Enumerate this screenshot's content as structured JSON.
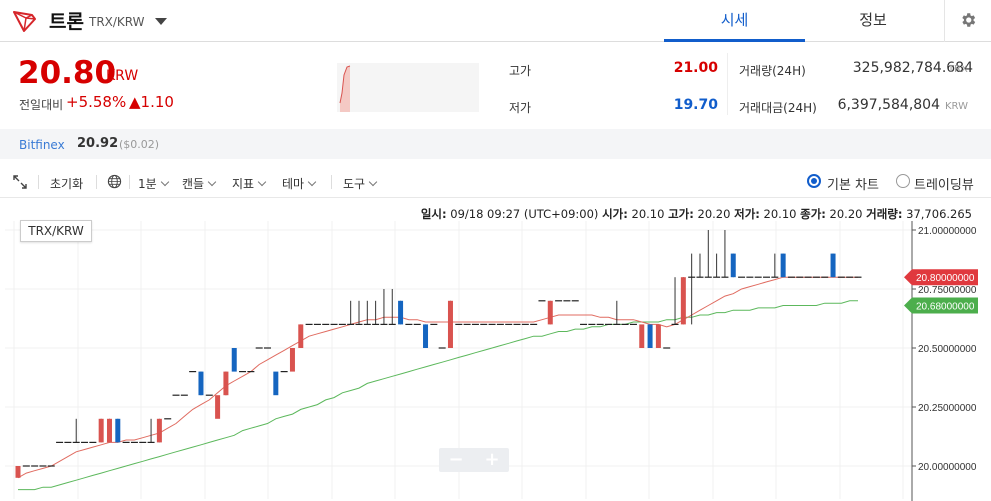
{
  "header": {
    "coin_name": "트론",
    "pair": "TRX/KRW",
    "tabs": [
      {
        "label": "시세",
        "active": true
      },
      {
        "label": "정보",
        "active": false
      }
    ],
    "logo_icon": "tron-logo-icon"
  },
  "price": {
    "current": "20.80",
    "unit": "KRW",
    "change_label": "전일대비",
    "change_pct": "+5.58%",
    "change_val": "▲1.10",
    "color_up": "#d60000",
    "color_down": "#115dcb"
  },
  "stats": {
    "high_label": "고가",
    "high": "21.00",
    "low_label": "저가",
    "low": "19.70",
    "volume_label": "거래량(24H)",
    "volume": "325,982,784.684",
    "volume_unit": "TRX",
    "amount_label": "거래대금(24H)",
    "amount": "6,397,584,804",
    "amount_unit": "KRW"
  },
  "exchange": {
    "name": "Bitfinex",
    "price": "20.92",
    "usd": "($0.02)"
  },
  "toolbar": {
    "reset": "초기화",
    "interval": "1분",
    "candle": "캔들",
    "indicator": "지표",
    "theme": "테마",
    "tools": "도구",
    "basic_chart": "기본 차트",
    "trading_view": "트레이딩뷰"
  },
  "chart_info": {
    "date_label": "일시:",
    "date": "09/18 09:27 (UTC+09:00)",
    "open_label": "시가:",
    "open": "20.10",
    "high_label": "고가:",
    "high": "20.20",
    "low_label": "저가:",
    "low": "20.10",
    "close_label": "종가:",
    "close": "20.20",
    "vol_label": "거래량:",
    "vol": "37,706.265",
    "symbol": "TRX/KRW"
  },
  "chart_data": {
    "type": "candlestick",
    "y_ticks": [
      "21.00000000",
      "20.75000000",
      "20.50000000",
      "20.25000000",
      "20.00000000"
    ],
    "ylim": [
      19.95,
      21.05
    ],
    "last_price_label": "20.80000000",
    "ma_label": "20.68000000",
    "up_color": "#d9534f",
    "down_color": "#1565c0",
    "ma_short_color": "#e06b60",
    "ma_long_color": "#5cb85c",
    "candles": [
      {
        "o": 19.95,
        "h": 19.95,
        "l": 19.95,
        "c": 20.0
      },
      {
        "o": 20.0,
        "h": 20.0,
        "l": 20.0,
        "c": 20.0
      },
      {
        "o": 20.0,
        "h": 20.0,
        "l": 20.0,
        "c": 20.0
      },
      {
        "o": 20.0,
        "h": 20.0,
        "l": 20.0,
        "c": 20.0
      },
      {
        "o": 20.0,
        "h": 20.0,
        "l": 20.0,
        "c": 20.0
      },
      {
        "o": 20.1,
        "h": 20.1,
        "l": 20.1,
        "c": 20.1
      },
      {
        "o": 20.1,
        "h": 20.1,
        "l": 20.1,
        "c": 20.1
      },
      {
        "o": 20.1,
        "h": 20.2,
        "l": 20.1,
        "c": 20.1
      },
      {
        "o": 20.1,
        "h": 20.1,
        "l": 20.1,
        "c": 20.1
      },
      {
        "o": 20.1,
        "h": 20.1,
        "l": 20.1,
        "c": 20.1
      },
      {
        "o": 20.1,
        "h": 20.2,
        "l": 20.1,
        "c": 20.2
      },
      {
        "o": 20.1,
        "h": 20.2,
        "l": 20.1,
        "c": 20.2
      },
      {
        "o": 20.2,
        "h": 20.2,
        "l": 20.1,
        "c": 20.1
      },
      {
        "o": 20.1,
        "h": 20.1,
        "l": 20.1,
        "c": 20.1
      },
      {
        "o": 20.1,
        "h": 20.1,
        "l": 20.1,
        "c": 20.1
      },
      {
        "o": 20.1,
        "h": 20.1,
        "l": 20.1,
        "c": 20.1
      },
      {
        "o": 20.1,
        "h": 20.2,
        "l": 20.1,
        "c": 20.1
      },
      {
        "o": 20.1,
        "h": 20.2,
        "l": 20.1,
        "c": 20.2
      },
      {
        "o": 20.2,
        "h": 20.2,
        "l": 20.2,
        "c": 20.2
      },
      {
        "o": 20.3,
        "h": 20.3,
        "l": 20.3,
        "c": 20.3
      },
      {
        "o": 20.3,
        "h": 20.3,
        "l": 20.3,
        "c": 20.3
      },
      {
        "o": 20.4,
        "h": 20.4,
        "l": 20.4,
        "c": 20.4
      },
      {
        "o": 20.4,
        "h": 20.4,
        "l": 20.3,
        "c": 20.3
      },
      {
        "o": 20.3,
        "h": 20.3,
        "l": 20.3,
        "c": 20.3
      },
      {
        "o": 20.2,
        "h": 20.2,
        "l": 20.2,
        "c": 20.3
      },
      {
        "o": 20.3,
        "h": 20.4,
        "l": 20.3,
        "c": 20.4
      },
      {
        "o": 20.5,
        "h": 20.5,
        "l": 20.5,
        "c": 20.4
      },
      {
        "o": 20.4,
        "h": 20.4,
        "l": 20.4,
        "c": 20.4
      },
      {
        "o": 20.4,
        "h": 20.4,
        "l": 20.4,
        "c": 20.4
      },
      {
        "o": 20.5,
        "h": 20.5,
        "l": 20.5,
        "c": 20.5
      },
      {
        "o": 20.5,
        "h": 20.5,
        "l": 20.5,
        "c": 20.5
      },
      {
        "o": 20.4,
        "h": 20.4,
        "l": 20.4,
        "c": 20.3
      },
      {
        "o": 20.4,
        "h": 20.4,
        "l": 20.4,
        "c": 20.4
      },
      {
        "o": 20.4,
        "h": 20.4,
        "l": 20.4,
        "c": 20.5
      },
      {
        "o": 20.5,
        "h": 20.6,
        "l": 20.5,
        "c": 20.6
      },
      {
        "o": 20.6,
        "h": 20.6,
        "l": 20.6,
        "c": 20.6
      },
      {
        "o": 20.6,
        "h": 20.6,
        "l": 20.6,
        "c": 20.6
      },
      {
        "o": 20.6,
        "h": 20.6,
        "l": 20.6,
        "c": 20.6
      },
      {
        "o": 20.6,
        "h": 20.6,
        "l": 20.6,
        "c": 20.6
      },
      {
        "o": 20.6,
        "h": 20.6,
        "l": 20.6,
        "c": 20.6
      },
      {
        "o": 20.6,
        "h": 20.7,
        "l": 20.6,
        "c": 20.6
      },
      {
        "o": 20.6,
        "h": 20.7,
        "l": 20.6,
        "c": 20.6
      },
      {
        "o": 20.6,
        "h": 20.7,
        "l": 20.6,
        "c": 20.6
      },
      {
        "o": 20.6,
        "h": 20.7,
        "l": 20.6,
        "c": 20.6
      },
      {
        "o": 20.6,
        "h": 20.75,
        "l": 20.6,
        "c": 20.6
      },
      {
        "o": 20.6,
        "h": 20.75,
        "l": 20.6,
        "c": 20.6
      },
      {
        "o": 20.7,
        "h": 20.7,
        "l": 20.6,
        "c": 20.6
      },
      {
        "o": 20.6,
        "h": 20.6,
        "l": 20.6,
        "c": 20.6
      },
      {
        "o": 20.6,
        "h": 20.6,
        "l": 20.6,
        "c": 20.6
      },
      {
        "o": 20.6,
        "h": 20.6,
        "l": 20.5,
        "c": 20.5
      },
      {
        "o": 20.6,
        "h": 20.6,
        "l": 20.6,
        "c": 20.6
      },
      {
        "o": 20.5,
        "h": 20.5,
        "l": 20.5,
        "c": 20.5
      },
      {
        "o": 20.5,
        "h": 20.7,
        "l": 20.5,
        "c": 20.7
      },
      {
        "o": 20.6,
        "h": 20.6,
        "l": 20.6,
        "c": 20.6
      },
      {
        "o": 20.6,
        "h": 20.6,
        "l": 20.6,
        "c": 20.6
      },
      {
        "o": 20.6,
        "h": 20.6,
        "l": 20.6,
        "c": 20.6
      },
      {
        "o": 20.6,
        "h": 20.6,
        "l": 20.6,
        "c": 20.6
      },
      {
        "o": 20.6,
        "h": 20.6,
        "l": 20.6,
        "c": 20.6
      },
      {
        "o": 20.6,
        "h": 20.6,
        "l": 20.6,
        "c": 20.6
      },
      {
        "o": 20.6,
        "h": 20.6,
        "l": 20.6,
        "c": 20.6
      },
      {
        "o": 20.6,
        "h": 20.6,
        "l": 20.6,
        "c": 20.6
      },
      {
        "o": 20.6,
        "h": 20.6,
        "l": 20.6,
        "c": 20.6
      },
      {
        "o": 20.6,
        "h": 20.6,
        "l": 20.6,
        "c": 20.6
      },
      {
        "o": 20.7,
        "h": 20.7,
        "l": 20.7,
        "c": 20.7
      },
      {
        "o": 20.6,
        "h": 20.7,
        "l": 20.6,
        "c": 20.7
      },
      {
        "o": 20.7,
        "h": 20.7,
        "l": 20.7,
        "c": 20.7
      },
      {
        "o": 20.7,
        "h": 20.7,
        "l": 20.7,
        "c": 20.7
      },
      {
        "o": 20.7,
        "h": 20.7,
        "l": 20.7,
        "c": 20.7
      },
      {
        "o": 20.6,
        "h": 20.6,
        "l": 20.6,
        "c": 20.6
      },
      {
        "o": 20.6,
        "h": 20.6,
        "l": 20.6,
        "c": 20.6
      },
      {
        "o": 20.6,
        "h": 20.6,
        "l": 20.6,
        "c": 20.6
      },
      {
        "o": 20.6,
        "h": 20.6,
        "l": 20.6,
        "c": 20.6
      },
      {
        "o": 20.6,
        "h": 20.7,
        "l": 20.6,
        "c": 20.6
      },
      {
        "o": 20.6,
        "h": 20.6,
        "l": 20.6,
        "c": 20.6
      },
      {
        "o": 20.6,
        "h": 20.6,
        "l": 20.6,
        "c": 20.6
      },
      {
        "o": 20.5,
        "h": 20.5,
        "l": 20.5,
        "c": 20.6
      },
      {
        "o": 20.6,
        "h": 20.6,
        "l": 20.5,
        "c": 20.5
      },
      {
        "o": 20.5,
        "h": 20.5,
        "l": 20.5,
        "c": 20.6
      },
      {
        "o": 20.5,
        "h": 20.5,
        "l": 20.5,
        "c": 20.5
      },
      {
        "o": 20.6,
        "h": 20.8,
        "l": 20.6,
        "c": 20.6
      },
      {
        "o": 20.6,
        "h": 20.8,
        "l": 20.6,
        "c": 20.8
      },
      {
        "o": 20.8,
        "h": 20.9,
        "l": 20.6,
        "c": 20.8
      },
      {
        "o": 20.8,
        "h": 20.9,
        "l": 20.8,
        "c": 20.8
      },
      {
        "o": 20.8,
        "h": 21.0,
        "l": 20.8,
        "c": 20.8
      },
      {
        "o": 20.8,
        "h": 20.9,
        "l": 20.8,
        "c": 20.8
      },
      {
        "o": 20.8,
        "h": 21.0,
        "l": 20.8,
        "c": 20.8
      },
      {
        "o": 20.9,
        "h": 20.9,
        "l": 20.8,
        "c": 20.8
      },
      {
        "o": 20.8,
        "h": 20.8,
        "l": 20.8,
        "c": 20.8
      },
      {
        "o": 20.8,
        "h": 20.8,
        "l": 20.8,
        "c": 20.8
      },
      {
        "o": 20.8,
        "h": 20.8,
        "l": 20.8,
        "c": 20.8
      },
      {
        "o": 20.8,
        "h": 20.8,
        "l": 20.8,
        "c": 20.8
      },
      {
        "o": 20.8,
        "h": 20.9,
        "l": 20.8,
        "c": 20.8
      },
      {
        "o": 20.9,
        "h": 20.9,
        "l": 20.8,
        "c": 20.8
      },
      {
        "o": 20.8,
        "h": 20.8,
        "l": 20.8,
        "c": 20.8
      },
      {
        "o": 20.8,
        "h": 20.8,
        "l": 20.8,
        "c": 20.8
      },
      {
        "o": 20.8,
        "h": 20.8,
        "l": 20.8,
        "c": 20.8
      },
      {
        "o": 20.8,
        "h": 20.8,
        "l": 20.8,
        "c": 20.8
      },
      {
        "o": 20.8,
        "h": 20.8,
        "l": 20.8,
        "c": 20.8
      },
      {
        "o": 20.9,
        "h": 20.9,
        "l": 20.8,
        "c": 20.8
      },
      {
        "o": 20.8,
        "h": 20.8,
        "l": 20.8,
        "c": 20.8
      },
      {
        "o": 20.8,
        "h": 20.8,
        "l": 20.8,
        "c": 20.8
      },
      {
        "o": 20.8,
        "h": 20.8,
        "l": 20.8,
        "c": 20.8
      }
    ],
    "ma_short": [
      19.95,
      19.97,
      19.98,
      19.99,
      20.0,
      20.02,
      20.04,
      20.06,
      20.07,
      20.08,
      20.09,
      20.1,
      20.1,
      20.11,
      20.11,
      20.12,
      20.13,
      20.14,
      20.16,
      20.18,
      20.21,
      20.24,
      20.26,
      20.28,
      20.31,
      20.34,
      20.36,
      20.38,
      20.4,
      20.43,
      20.45,
      20.47,
      20.49,
      20.51,
      20.53,
      20.55,
      20.56,
      20.57,
      20.58,
      20.59,
      20.6,
      20.61,
      20.62,
      20.62,
      20.63,
      20.63,
      20.63,
      20.62,
      20.62,
      20.61,
      20.61,
      20.61,
      20.61,
      20.61,
      20.61,
      20.61,
      20.61,
      20.61,
      20.61,
      20.61,
      20.61,
      20.61,
      20.61,
      20.62,
      20.63,
      20.64,
      20.64,
      20.64,
      20.64,
      20.64,
      20.63,
      20.63,
      20.62,
      20.62,
      20.62,
      20.61,
      20.6,
      20.6,
      20.59,
      20.6,
      20.62,
      20.64,
      20.66,
      20.68,
      20.7,
      20.72,
      20.73,
      20.75,
      20.76,
      20.77,
      20.78,
      20.79,
      20.8,
      20.8,
      20.8,
      20.8,
      20.8,
      20.8,
      20.8,
      20.8,
      20.8,
      20.8
    ],
    "ma_long": [
      19.9,
      19.9,
      19.9,
      19.91,
      19.91,
      19.92,
      19.93,
      19.94,
      19.95,
      19.96,
      19.97,
      19.98,
      19.99,
      20.0,
      20.01,
      20.02,
      20.03,
      20.04,
      20.05,
      20.06,
      20.07,
      20.08,
      20.09,
      20.1,
      20.11,
      20.12,
      20.13,
      20.15,
      20.16,
      20.17,
      20.18,
      20.2,
      20.21,
      20.22,
      20.24,
      20.25,
      20.26,
      20.28,
      20.29,
      20.31,
      20.32,
      20.33,
      20.35,
      20.36,
      20.37,
      20.38,
      20.39,
      20.4,
      20.41,
      20.42,
      20.43,
      20.44,
      20.45,
      20.46,
      20.47,
      20.48,
      20.49,
      20.5,
      20.51,
      20.52,
      20.53,
      20.54,
      20.55,
      20.55,
      20.56,
      20.57,
      20.57,
      20.58,
      20.58,
      20.59,
      20.59,
      20.6,
      20.6,
      20.6,
      20.61,
      20.61,
      20.61,
      20.61,
      20.62,
      20.62,
      20.63,
      20.63,
      20.64,
      20.64,
      20.65,
      20.65,
      20.66,
      20.66,
      20.66,
      20.67,
      20.67,
      20.67,
      20.68,
      20.68,
      20.68,
      20.68,
      20.68,
      20.69,
      20.69,
      20.69,
      20.7,
      20.7
    ]
  }
}
